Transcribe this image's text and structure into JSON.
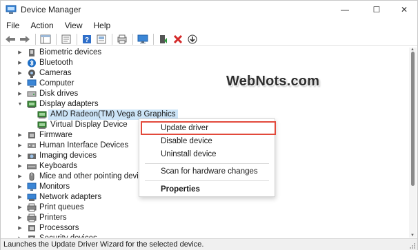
{
  "window": {
    "title": "Device Manager",
    "controls": {
      "minimize": "—",
      "maximize": "☐",
      "close": "✕"
    }
  },
  "menubar": [
    "File",
    "Action",
    "View",
    "Help"
  ],
  "toolbar": {
    "buttons": [
      {
        "name": "back-arrow-icon"
      },
      {
        "name": "forward-arrow-icon"
      },
      {
        "name": "show-hide-console-tree-icon"
      },
      {
        "name": "properties-icon"
      },
      {
        "name": "help-icon"
      },
      {
        "name": "update-driver-icon"
      },
      {
        "name": "scan-hardware-icon"
      },
      {
        "name": "add-legacy-hardware-icon"
      },
      {
        "name": "uninstall-icon"
      },
      {
        "name": "download-icon"
      }
    ]
  },
  "tree": {
    "rows": [
      {
        "label": "Biometric devices",
        "level": 1,
        "expanded": false,
        "icon": "biometric-icon"
      },
      {
        "label": "Bluetooth",
        "level": 1,
        "expanded": false,
        "icon": "bluetooth-icon"
      },
      {
        "label": "Cameras",
        "level": 1,
        "expanded": false,
        "icon": "camera-icon"
      },
      {
        "label": "Computer",
        "level": 1,
        "expanded": false,
        "icon": "computer-icon"
      },
      {
        "label": "Disk drives",
        "level": 1,
        "expanded": false,
        "icon": "disk-icon"
      },
      {
        "label": "Display adapters",
        "level": 1,
        "expanded": true,
        "icon": "display-adapter-icon"
      },
      {
        "label": "AMD Radeon(TM) Vega 8 Graphics",
        "level": 2,
        "selected": true,
        "icon": "display-adapter-icon"
      },
      {
        "label": "Virtual Display Device",
        "level": 2,
        "selected": false,
        "icon": "display-adapter-icon"
      },
      {
        "label": "Firmware",
        "level": 1,
        "expanded": false,
        "icon": "firmware-icon"
      },
      {
        "label": "Human Interface Devices",
        "level": 1,
        "expanded": false,
        "icon": "hid-icon"
      },
      {
        "label": "Imaging devices",
        "level": 1,
        "expanded": false,
        "icon": "imaging-icon"
      },
      {
        "label": "Keyboards",
        "level": 1,
        "expanded": false,
        "icon": "keyboard-icon"
      },
      {
        "label": "Mice and other pointing devices",
        "level": 1,
        "expanded": false,
        "icon": "mouse-icon"
      },
      {
        "label": "Monitors",
        "level": 1,
        "expanded": false,
        "icon": "monitor-icon"
      },
      {
        "label": "Network adapters",
        "level": 1,
        "expanded": false,
        "icon": "network-icon"
      },
      {
        "label": "Print queues",
        "level": 1,
        "expanded": false,
        "icon": "printer-icon"
      },
      {
        "label": "Printers",
        "level": 1,
        "expanded": false,
        "icon": "printer-icon"
      },
      {
        "label": "Processors",
        "level": 1,
        "expanded": false,
        "icon": "processor-icon"
      },
      {
        "label": "Security devices",
        "level": 1,
        "expanded": false,
        "icon": "security-icon"
      }
    ]
  },
  "watermark": "WebNots.com",
  "context_menu": {
    "items": [
      {
        "label": "Update driver",
        "highlighted": true
      },
      {
        "label": "Disable device"
      },
      {
        "label": "Uninstall device"
      },
      {
        "label": "Scan for hardware changes"
      },
      {
        "label": "Properties",
        "bold": true
      }
    ]
  },
  "statusbar": "Launches the Update Driver Wizard for the selected device.",
  "colors": {
    "selection": "#cce4f7",
    "highlight_border": "#e2493b",
    "accent": "#1f6fc5"
  }
}
